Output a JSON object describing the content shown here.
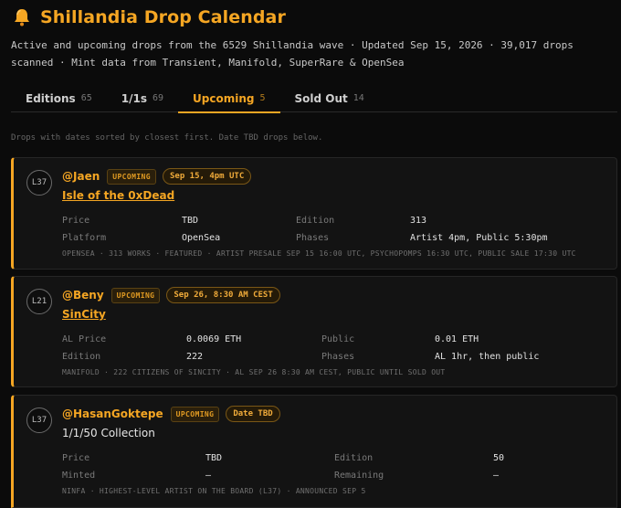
{
  "app": {
    "title": "Shillandia Drop Calendar",
    "subtitle": "Active and upcoming drops from the 6529 Shillandia wave · Updated Sep 15, 2026 · 39,017 drops scanned · Mint data from Transient, Manifold, SuperRare & OpenSea",
    "icon": "bell-icon",
    "accent_color": "#f5a623"
  },
  "tabs": [
    {
      "label": "Editions",
      "count": "65",
      "active": false
    },
    {
      "label": "1/1s",
      "count": "69",
      "active": false
    },
    {
      "label": "Upcoming",
      "count": "5",
      "active": true
    },
    {
      "label": "Sold Out",
      "count": "14",
      "active": false
    }
  ],
  "note": "Drops with dates sorted by closest first. Date TBD drops below.",
  "drops": [
    {
      "level": "L37",
      "handle": "@Jaen",
      "status": "UPCOMING",
      "date": "Sep 15, 4pm UTC",
      "project": "Isle of the 0xDead",
      "fields": [
        [
          "Price",
          "TBD",
          "Edition",
          "313"
        ],
        [
          "Platform",
          "OpenSea",
          "Phases",
          "Artist 4pm, Public 5:30pm"
        ]
      ],
      "footer": "OPENSEA · 313 WORKS · FEATURED · ARTIST PRESALE SEP 15 16:00 UTC, PSYCHOPOMPS 16:30 UTC, PUBLIC SALE 17:30 UTC"
    },
    {
      "level": "L21",
      "handle": "@Beny",
      "status": "UPCOMING",
      "date": "Sep 26, 8:30 AM CEST",
      "project": "SinCity",
      "fields": [
        [
          "AL Price",
          "0.0069 ETH",
          "Public",
          "0.01 ETH"
        ],
        [
          "Edition",
          "222",
          "Phases",
          "AL 1hr, then public"
        ]
      ],
      "footer": "MANIFOLD · 222 CITIZENS OF SINCITY · AL SEP 26 8:30 AM CEST, PUBLIC UNTIL SOLD OUT"
    },
    {
      "level": "L37",
      "handle": "@HasanGoktepe",
      "status": "UPCOMING",
      "date": "Date TBD",
      "project": "1/1/50 Collection",
      "fields": [
        [
          "Price",
          "TBD",
          "Edition",
          "50"
        ],
        [
          "Minted",
          "—",
          "Remaining",
          "—"
        ]
      ],
      "footer": "NINFA · HIGHEST-LEVEL ARTIST ON THE BOARD (L37) · ANNOUNCED SEP 5"
    }
  ]
}
